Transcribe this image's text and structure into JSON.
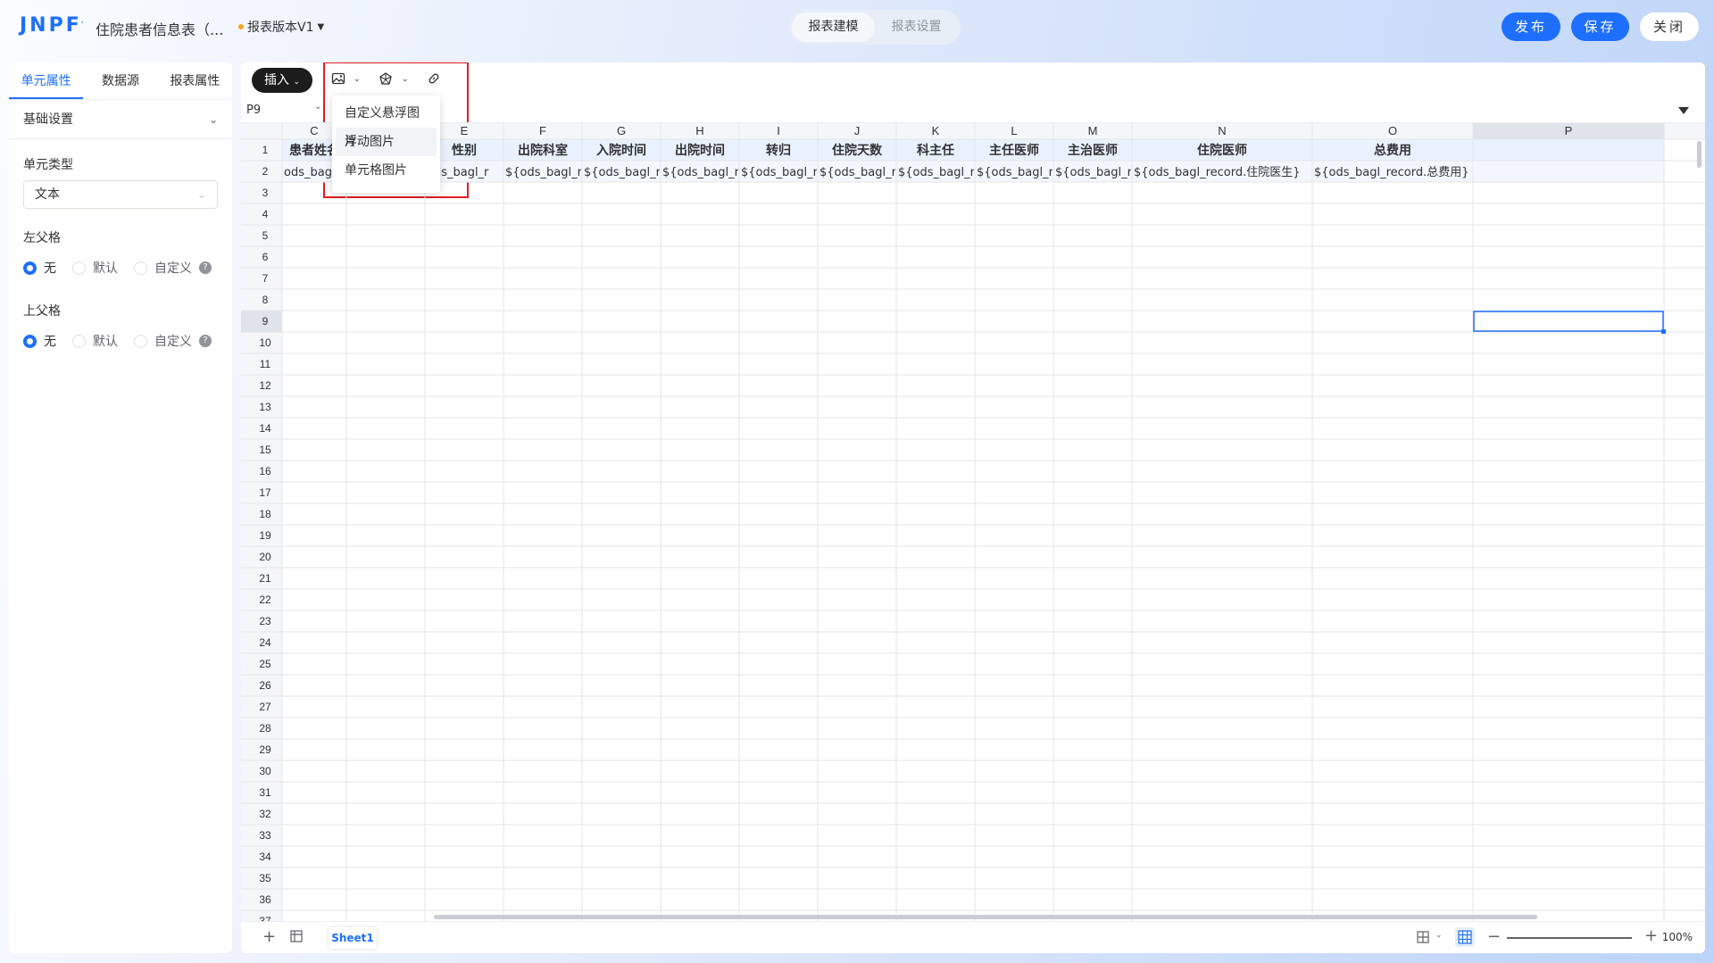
{
  "header": {
    "logo": "JNPF",
    "title": "住院患者信息表（...",
    "version": "报表版本V1",
    "modes": [
      "报表建模",
      "报表设置"
    ],
    "active_mode": 0,
    "publish_label": "发布",
    "save_label": "保存",
    "close_label": "关闭"
  },
  "left_panel": {
    "tabs": [
      "单元属性",
      "数据源",
      "报表属性"
    ],
    "active_tab": 0,
    "section_title": "基础设置",
    "cell_type_label": "单元类型",
    "cell_type_value": "文本",
    "left_parent_label": "左父格",
    "top_parent_label": "上父格",
    "parent_options": [
      "无",
      "默认",
      "自定义"
    ],
    "left_parent_selected": 0,
    "top_parent_selected": 0
  },
  "toolbar": {
    "insert_label": "插入",
    "dropdown_items": [
      "自定义悬浮图片",
      "浮动图片",
      "单元格图片"
    ],
    "dropdown_hover": 1
  },
  "formula_bar": {
    "cell_ref": "P9"
  },
  "grid": {
    "columns": [
      "C",
      "D",
      "E",
      "F",
      "G",
      "H",
      "I",
      "J",
      "K",
      "L",
      "M",
      "N",
      "O",
      "P"
    ],
    "row1": [
      "患者姓名",
      "",
      "性别",
      "出院科室",
      "入院时间",
      "出院时间",
      "转归",
      "住院天数",
      "科主任",
      "主任医师",
      "主治医师",
      "住院医师",
      "总费用",
      ""
    ],
    "row2": [
      "ods_bag",
      "",
      "ods_bagl_r",
      "${ods_bagl_r",
      "${ods_bagl_r",
      "${ods_bagl_r",
      "${ods_bagl_r",
      "${ods_bagl_r",
      "${ods_bagl_r",
      "${ods_bagl_r",
      "${ods_bagl_r",
      "${ods_bagl_record.住院医生}",
      "${ods_bagl_record.总费用}",
      ""
    ],
    "row_count": 37,
    "selected_row": 9,
    "selected_col": "P"
  },
  "sheetbar": {
    "sheet_name": "Sheet1",
    "zoom": "100%"
  },
  "colors": {
    "accent": "#1e6fff",
    "header_row_bg": "#e8f1fd",
    "selection": "#1e6fff"
  }
}
